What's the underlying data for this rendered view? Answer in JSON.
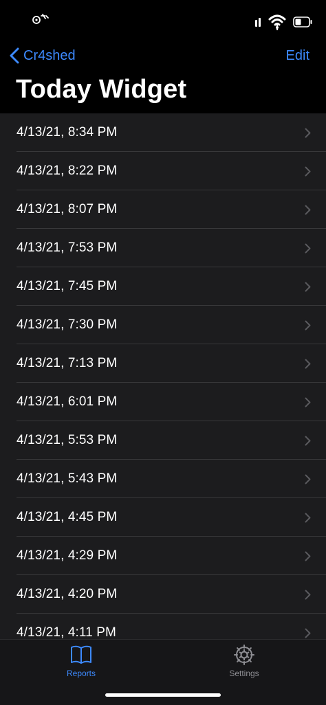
{
  "status_bar": {
    "left_icon": "activity-status-icon",
    "right_icons": [
      "signal-icon",
      "wifi-icon",
      "battery-icon"
    ]
  },
  "nav": {
    "back_label": "Cr4shed",
    "edit_label": "Edit",
    "title": "Today Widget"
  },
  "reports": [
    {
      "label": "4/13/21, 8:34 PM"
    },
    {
      "label": "4/13/21, 8:22 PM"
    },
    {
      "label": "4/13/21, 8:07 PM"
    },
    {
      "label": "4/13/21, 7:53 PM"
    },
    {
      "label": "4/13/21, 7:45 PM"
    },
    {
      "label": "4/13/21, 7:30 PM"
    },
    {
      "label": "4/13/21, 7:13 PM"
    },
    {
      "label": "4/13/21, 6:01 PM"
    },
    {
      "label": "4/13/21, 5:53 PM"
    },
    {
      "label": "4/13/21, 5:43 PM"
    },
    {
      "label": "4/13/21, 4:45 PM"
    },
    {
      "label": "4/13/21, 4:29 PM"
    },
    {
      "label": "4/13/21, 4:20 PM"
    },
    {
      "label": "4/13/21, 4:11 PM"
    }
  ],
  "tab_bar": {
    "reports_label": "Reports",
    "settings_label": "Settings",
    "active": "Reports"
  },
  "colors": {
    "accent": "#3d8aff",
    "background": "#000000",
    "list_background": "#1c1c1e",
    "separator": "#38383a",
    "inactive_tab": "#8e8e93"
  }
}
